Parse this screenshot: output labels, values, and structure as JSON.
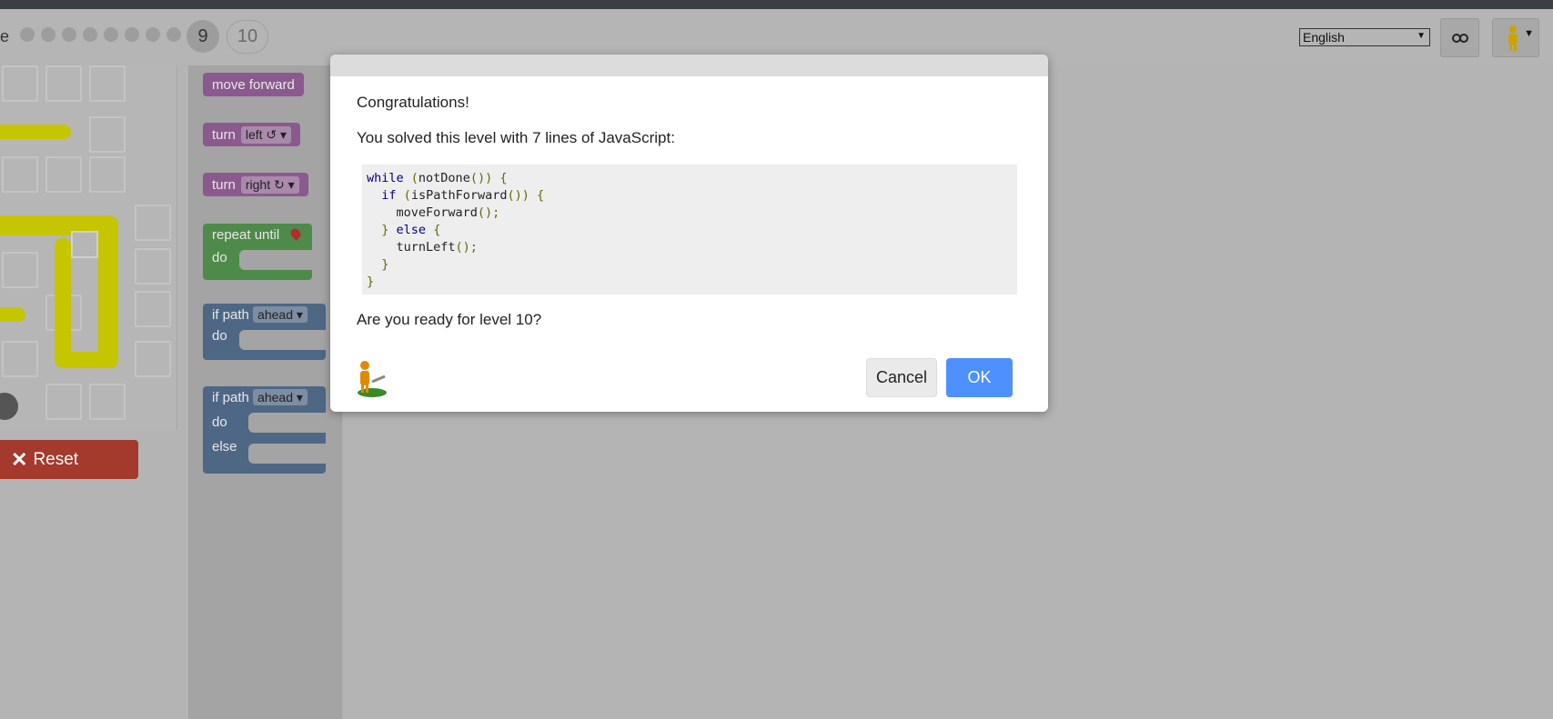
{
  "header": {
    "title_fragment": "e",
    "levels": [
      "1",
      "2",
      "3",
      "4",
      "5",
      "6",
      "7",
      "8"
    ],
    "current_level": "9",
    "next_level": "10",
    "language": "English",
    "link_icon": "link-icon",
    "avatar_icon": "pegman-icon"
  },
  "toolbox": {
    "move_forward": "move forward",
    "turn": "turn",
    "left": "left ↺ ▾",
    "right": "right ↻ ▾",
    "repeat_until": "repeat until",
    "do": "do",
    "if_path": "if path",
    "ahead": "ahead ▾",
    "else": "else"
  },
  "reset": {
    "label": "Reset"
  },
  "dialog": {
    "title": "Congratulations!",
    "summary": "You solved this level with 7 lines of JavaScript:",
    "code_lines": [
      "while (notDone()) {",
      "  if (isPathForward()) {",
      "    moveForward();",
      "  } else {",
      "    turnLeft();",
      "  }",
      "}"
    ],
    "question": "Are you ready for level 10?",
    "cancel": "Cancel",
    "ok": "OK"
  },
  "colors": {
    "ok_button": "#4d90fe",
    "reset_button": "#a33a2c",
    "block_purple": "#8a5a8e",
    "block_green": "#4e8a49",
    "block_blue": "#4e6785"
  }
}
